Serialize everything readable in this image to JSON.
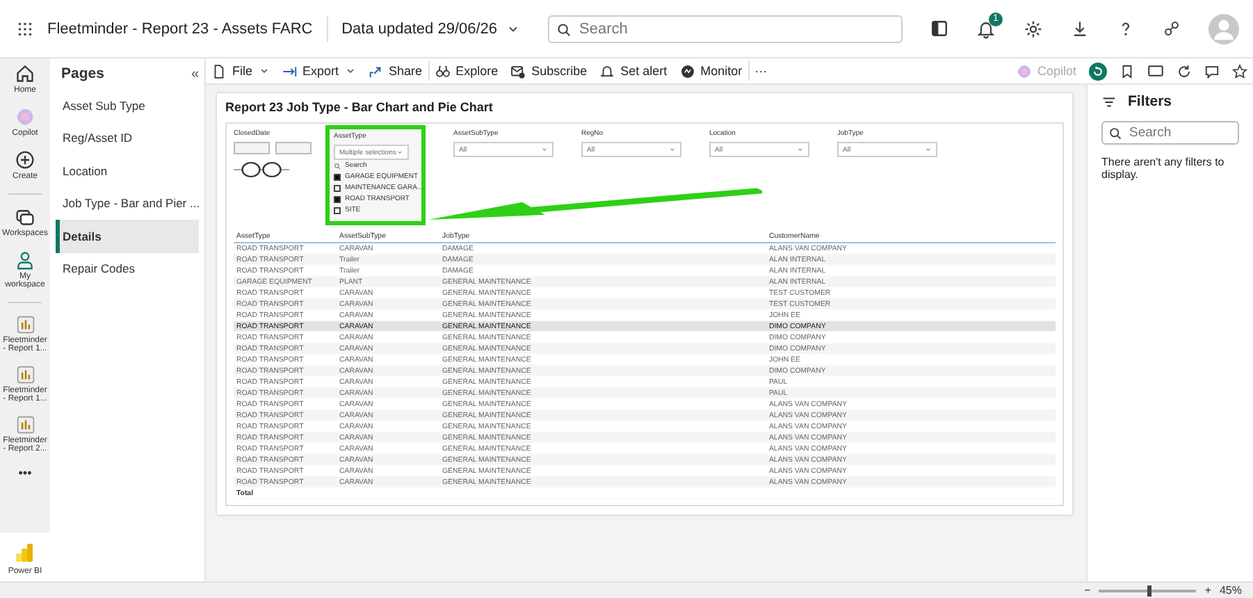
{
  "top_bar": {
    "app_title": "Fleetminder - Report 23 - Assets FARC",
    "data_updated": "Data updated 29/06/26",
    "search": {
      "placeholder": "Search"
    },
    "notification_count": "1"
  },
  "toolbar": {
    "items": [
      {
        "kind": "menu",
        "label": "File"
      },
      {
        "kind": "menu",
        "label": "Export"
      },
      {
        "kind": "button",
        "label": "Share"
      },
      {
        "kind": "button",
        "label": "Explore"
      },
      {
        "kind": "button",
        "label": "Subscribe"
      },
      {
        "kind": "button",
        "label": "Set alert"
      },
      {
        "kind": "button",
        "label": "Monitor"
      },
      {
        "kind": "more",
        "label": "···"
      }
    ],
    "copilot": {
      "label": "Copilot",
      "disabled": true
    }
  },
  "nav_rail": {
    "items": [
      {
        "kind": "home",
        "label": "Home"
      },
      {
        "kind": "copilot",
        "label": "Copilot"
      },
      {
        "kind": "create",
        "label": "Create"
      },
      {
        "kind": "workspaces",
        "label": "Workspaces"
      },
      {
        "kind": "person",
        "label": "My workspace"
      },
      {
        "kind": "report",
        "label": "Fleetminder - Report 1..."
      },
      {
        "kind": "report",
        "label": "Fleetminder - Report 1..."
      },
      {
        "kind": "report",
        "label": "Fleetminder - Report 2..."
      },
      {
        "kind": "more",
        "label": "•••"
      }
    ],
    "product": "Power BI"
  },
  "pages": {
    "title": "Pages",
    "collapse": "«",
    "items": [
      {
        "label": "Asset Sub Type",
        "selected": false
      },
      {
        "label": "Reg/Asset ID",
        "selected": false
      },
      {
        "label": "Location",
        "selected": false
      },
      {
        "label": "Job Type - Bar and Pier ...",
        "selected": false
      },
      {
        "label": "Details",
        "selected": true
      },
      {
        "label": "Repair Codes",
        "selected": false
      }
    ]
  },
  "report": {
    "title": "Report 23 Job Type - Bar Chart and Pie Chart",
    "date_slicer": {
      "label": "ClosedDate"
    },
    "asset_type_slicer": {
      "label": "AssetType",
      "value": "Multiple selections",
      "search": "Search",
      "options": [
        {
          "label": "GARAGE EQUIPMENT",
          "checked": true
        },
        {
          "label": "MAINTENANCE GARA...",
          "checked": false
        },
        {
          "label": "ROAD TRANSPORT",
          "checked": true
        },
        {
          "label": "SITE",
          "checked": false
        }
      ]
    },
    "slicers": [
      {
        "label": "AssetSubType",
        "value": "All"
      },
      {
        "label": "RegNo",
        "value": "All"
      },
      {
        "label": "Location",
        "value": "All"
      },
      {
        "label": "JobType",
        "value": "All"
      }
    ],
    "table": {
      "columns": [
        "AssetType",
        "AssetSubType",
        "JobType",
        "CustomerName"
      ],
      "rows": [
        {
          "cells": [
            "ROAD TRANSPORT",
            "CARAVAN",
            "DAMAGE",
            "ALANS VAN COMPANY"
          ],
          "selected": false
        },
        {
          "cells": [
            "ROAD TRANSPORT",
            "Trailer",
            "DAMAGE",
            "ALAN INTERNAL"
          ],
          "selected": false
        },
        {
          "cells": [
            "ROAD TRANSPORT",
            "Trailer",
            "DAMAGE",
            "ALAN INTERNAL"
          ],
          "selected": false
        },
        {
          "cells": [
            "GARAGE EQUIPMENT",
            "PLANT",
            "GENERAL MAINTENANCE",
            "ALAN INTERNAL"
          ],
          "selected": false
        },
        {
          "cells": [
            "ROAD TRANSPORT",
            "CARAVAN",
            "GENERAL MAINTENANCE",
            "TEST CUSTOMER"
          ],
          "selected": false
        },
        {
          "cells": [
            "ROAD TRANSPORT",
            "CARAVAN",
            "GENERAL MAINTENANCE",
            "TEST CUSTOMER"
          ],
          "selected": false
        },
        {
          "cells": [
            "ROAD TRANSPORT",
            "CARAVAN",
            "GENERAL MAINTENANCE",
            "JOHN EE"
          ],
          "selected": false
        },
        {
          "cells": [
            "ROAD TRANSPORT",
            "CARAVAN",
            "GENERAL MAINTENANCE",
            "DIMO COMPANY"
          ],
          "selected": true
        },
        {
          "cells": [
            "ROAD TRANSPORT",
            "CARAVAN",
            "GENERAL MAINTENANCE",
            "DIMO COMPANY"
          ],
          "selected": false
        },
        {
          "cells": [
            "ROAD TRANSPORT",
            "CARAVAN",
            "GENERAL MAINTENANCE",
            "DIMO COMPANY"
          ],
          "selected": false
        },
        {
          "cells": [
            "ROAD TRANSPORT",
            "CARAVAN",
            "GENERAL MAINTENANCE",
            "JOHN EE"
          ],
          "selected": false
        },
        {
          "cells": [
            "ROAD TRANSPORT",
            "CARAVAN",
            "GENERAL MAINTENANCE",
            "DIMO COMPANY"
          ],
          "selected": false
        },
        {
          "cells": [
            "ROAD TRANSPORT",
            "CARAVAN",
            "GENERAL MAINTENANCE",
            "PAUL"
          ],
          "selected": false
        },
        {
          "cells": [
            "ROAD TRANSPORT",
            "CARAVAN",
            "GENERAL MAINTENANCE",
            "PAUL"
          ],
          "selected": false
        },
        {
          "cells": [
            "ROAD TRANSPORT",
            "CARAVAN",
            "GENERAL MAINTENANCE",
            "ALANS VAN COMPANY"
          ],
          "selected": false
        },
        {
          "cells": [
            "ROAD TRANSPORT",
            "CARAVAN",
            "GENERAL MAINTENANCE",
            "ALANS VAN COMPANY"
          ],
          "selected": false
        },
        {
          "cells": [
            "ROAD TRANSPORT",
            "CARAVAN",
            "GENERAL MAINTENANCE",
            "ALANS VAN COMPANY"
          ],
          "selected": false
        },
        {
          "cells": [
            "ROAD TRANSPORT",
            "CARAVAN",
            "GENERAL MAINTENANCE",
            "ALANS VAN COMPANY"
          ],
          "selected": false
        },
        {
          "cells": [
            "ROAD TRANSPORT",
            "CARAVAN",
            "GENERAL MAINTENANCE",
            "ALANS VAN COMPANY"
          ],
          "selected": false
        },
        {
          "cells": [
            "ROAD TRANSPORT",
            "CARAVAN",
            "GENERAL MAINTENANCE",
            "ALANS VAN COMPANY"
          ],
          "selected": false
        },
        {
          "cells": [
            "ROAD TRANSPORT",
            "CARAVAN",
            "GENERAL MAINTENANCE",
            "ALANS VAN COMPANY"
          ],
          "selected": false
        },
        {
          "cells": [
            "ROAD TRANSPORT",
            "CARAVAN",
            "GENERAL MAINTENANCE",
            "ALANS VAN COMPANY"
          ],
          "selected": false
        }
      ],
      "total_label": "Total"
    }
  },
  "filters": {
    "title": "Filters",
    "search": {
      "placeholder": "Search"
    },
    "empty_message": "There aren't any filters to display."
  },
  "status_bar": {
    "zoom": "45%",
    "zoom_out": "−",
    "zoom_in": "+",
    "zoom_slider": {
      "level": 0.5
    }
  }
}
